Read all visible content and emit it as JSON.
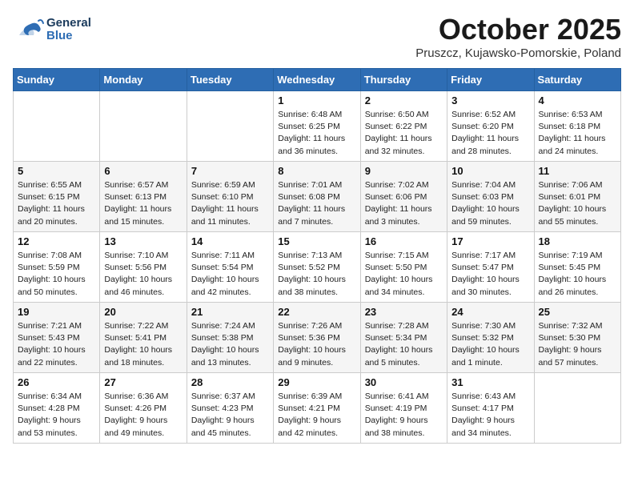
{
  "header": {
    "logo_line1": "General",
    "logo_line2": "Blue",
    "month": "October 2025",
    "location": "Pruszcz, Kujawsko-Pomorskie, Poland"
  },
  "weekdays": [
    "Sunday",
    "Monday",
    "Tuesday",
    "Wednesday",
    "Thursday",
    "Friday",
    "Saturday"
  ],
  "weeks": [
    [
      {
        "day": "",
        "content": ""
      },
      {
        "day": "",
        "content": ""
      },
      {
        "day": "",
        "content": ""
      },
      {
        "day": "1",
        "content": "Sunrise: 6:48 AM\nSunset: 6:25 PM\nDaylight: 11 hours\nand 36 minutes."
      },
      {
        "day": "2",
        "content": "Sunrise: 6:50 AM\nSunset: 6:22 PM\nDaylight: 11 hours\nand 32 minutes."
      },
      {
        "day": "3",
        "content": "Sunrise: 6:52 AM\nSunset: 6:20 PM\nDaylight: 11 hours\nand 28 minutes."
      },
      {
        "day": "4",
        "content": "Sunrise: 6:53 AM\nSunset: 6:18 PM\nDaylight: 11 hours\nand 24 minutes."
      }
    ],
    [
      {
        "day": "5",
        "content": "Sunrise: 6:55 AM\nSunset: 6:15 PM\nDaylight: 11 hours\nand 20 minutes."
      },
      {
        "day": "6",
        "content": "Sunrise: 6:57 AM\nSunset: 6:13 PM\nDaylight: 11 hours\nand 15 minutes."
      },
      {
        "day": "7",
        "content": "Sunrise: 6:59 AM\nSunset: 6:10 PM\nDaylight: 11 hours\nand 11 minutes."
      },
      {
        "day": "8",
        "content": "Sunrise: 7:01 AM\nSunset: 6:08 PM\nDaylight: 11 hours\nand 7 minutes."
      },
      {
        "day": "9",
        "content": "Sunrise: 7:02 AM\nSunset: 6:06 PM\nDaylight: 11 hours\nand 3 minutes."
      },
      {
        "day": "10",
        "content": "Sunrise: 7:04 AM\nSunset: 6:03 PM\nDaylight: 10 hours\nand 59 minutes."
      },
      {
        "day": "11",
        "content": "Sunrise: 7:06 AM\nSunset: 6:01 PM\nDaylight: 10 hours\nand 55 minutes."
      }
    ],
    [
      {
        "day": "12",
        "content": "Sunrise: 7:08 AM\nSunset: 5:59 PM\nDaylight: 10 hours\nand 50 minutes."
      },
      {
        "day": "13",
        "content": "Sunrise: 7:10 AM\nSunset: 5:56 PM\nDaylight: 10 hours\nand 46 minutes."
      },
      {
        "day": "14",
        "content": "Sunrise: 7:11 AM\nSunset: 5:54 PM\nDaylight: 10 hours\nand 42 minutes."
      },
      {
        "day": "15",
        "content": "Sunrise: 7:13 AM\nSunset: 5:52 PM\nDaylight: 10 hours\nand 38 minutes."
      },
      {
        "day": "16",
        "content": "Sunrise: 7:15 AM\nSunset: 5:50 PM\nDaylight: 10 hours\nand 34 minutes."
      },
      {
        "day": "17",
        "content": "Sunrise: 7:17 AM\nSunset: 5:47 PM\nDaylight: 10 hours\nand 30 minutes."
      },
      {
        "day": "18",
        "content": "Sunrise: 7:19 AM\nSunset: 5:45 PM\nDaylight: 10 hours\nand 26 minutes."
      }
    ],
    [
      {
        "day": "19",
        "content": "Sunrise: 7:21 AM\nSunset: 5:43 PM\nDaylight: 10 hours\nand 22 minutes."
      },
      {
        "day": "20",
        "content": "Sunrise: 7:22 AM\nSunset: 5:41 PM\nDaylight: 10 hours\nand 18 minutes."
      },
      {
        "day": "21",
        "content": "Sunrise: 7:24 AM\nSunset: 5:38 PM\nDaylight: 10 hours\nand 13 minutes."
      },
      {
        "day": "22",
        "content": "Sunrise: 7:26 AM\nSunset: 5:36 PM\nDaylight: 10 hours\nand 9 minutes."
      },
      {
        "day": "23",
        "content": "Sunrise: 7:28 AM\nSunset: 5:34 PM\nDaylight: 10 hours\nand 5 minutes."
      },
      {
        "day": "24",
        "content": "Sunrise: 7:30 AM\nSunset: 5:32 PM\nDaylight: 10 hours\nand 1 minute."
      },
      {
        "day": "25",
        "content": "Sunrise: 7:32 AM\nSunset: 5:30 PM\nDaylight: 9 hours\nand 57 minutes."
      }
    ],
    [
      {
        "day": "26",
        "content": "Sunrise: 6:34 AM\nSunset: 4:28 PM\nDaylight: 9 hours\nand 53 minutes."
      },
      {
        "day": "27",
        "content": "Sunrise: 6:36 AM\nSunset: 4:26 PM\nDaylight: 9 hours\nand 49 minutes."
      },
      {
        "day": "28",
        "content": "Sunrise: 6:37 AM\nSunset: 4:23 PM\nDaylight: 9 hours\nand 45 minutes."
      },
      {
        "day": "29",
        "content": "Sunrise: 6:39 AM\nSunset: 4:21 PM\nDaylight: 9 hours\nand 42 minutes."
      },
      {
        "day": "30",
        "content": "Sunrise: 6:41 AM\nSunset: 4:19 PM\nDaylight: 9 hours\nand 38 minutes."
      },
      {
        "day": "31",
        "content": "Sunrise: 6:43 AM\nSunset: 4:17 PM\nDaylight: 9 hours\nand 34 minutes."
      },
      {
        "day": "",
        "content": ""
      }
    ]
  ]
}
